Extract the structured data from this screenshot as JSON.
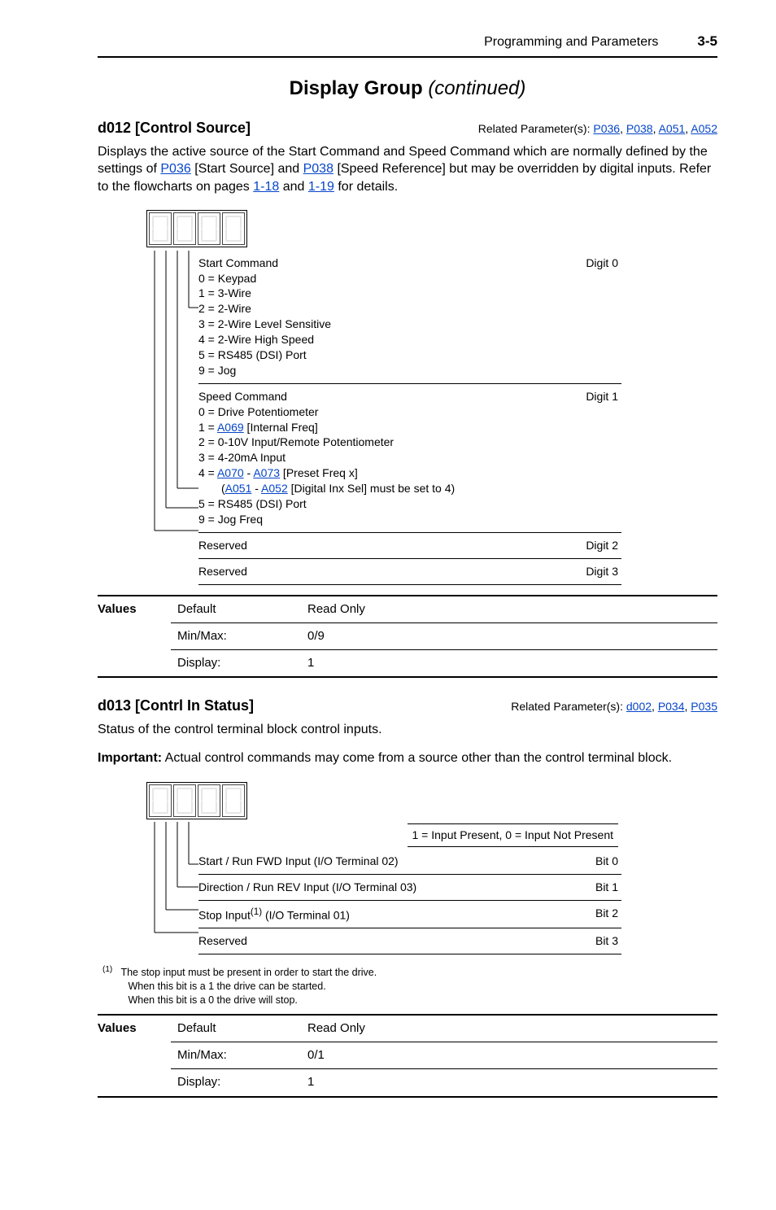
{
  "header": {
    "title": "Programming and Parameters",
    "page": "3-5"
  },
  "section": {
    "title": "Display Group",
    "cont": "(continued)"
  },
  "d012": {
    "name": "d012 [Control Source]",
    "related_label": "Related Parameter(s): ",
    "related_links": [
      {
        "text": "P036"
      },
      {
        "text": "P038"
      },
      {
        "text": "A051"
      },
      {
        "text": "A052"
      }
    ],
    "desc_pre": "Displays the active source of the Start Command and Speed Command which are normally defined by the settings of ",
    "desc_mid1": " [Start Source] and ",
    "desc_mid2": " [Speed Reference] but may be overridden by digital inputs. Refer to the flowcharts on pages ",
    "desc_and": " and ",
    "desc_post": " for details.",
    "link_p036": "P036",
    "link_p038": "P038",
    "link_118": "1-18",
    "link_119": "1-19",
    "rows": {
      "r0_label": "Start Command",
      "r0_lines": [
        "0 = Keypad",
        "1 = 3-Wire",
        "2 = 2-Wire",
        "3 = 2-Wire Level Sensitive",
        "4 = 2-Wire High Speed",
        "5 = RS485 (DSI) Port",
        "9 = Jog"
      ],
      "r0_digit": "Digit 0",
      "r1_label": "Speed Command",
      "r1_lines_pre": "0 = Drive Potentiometer",
      "r1_l2a": "1 = ",
      "r1_l2_link": "A069",
      "r1_l2b": " [Internal Freq]",
      "r1_l3": "2 = 0-10V Input/Remote Potentiometer",
      "r1_l4": "3 = 4-20mA Input",
      "r1_l5a": "4 = ",
      "r1_l5_link1": "A070",
      "r1_l5_mid": " - ",
      "r1_l5_link2": "A073",
      "r1_l5b": " [Preset Freq x]",
      "r1_l6a": "(",
      "r1_l6_link1": "A051",
      "r1_l6_mid": " - ",
      "r1_l6_link2": "A052",
      "r1_l6b": " [Digital Inx Sel] must be set to 4)",
      "r1_l7": "5 = RS485 (DSI) Port",
      "r1_l8": "9 = Jog Freq",
      "r1_digit": "Digit 1",
      "r2_label": "Reserved",
      "r2_digit": "Digit 2",
      "r3_label": "Reserved",
      "r3_digit": "Digit 3"
    },
    "values": {
      "label": "Values",
      "default_k": "Default",
      "default_v": "Read Only",
      "minmax_k": "Min/Max:",
      "minmax_v": "0/9",
      "display_k": "Display:",
      "display_v": "1"
    }
  },
  "d013": {
    "name": "d013 [Contrl In Status]",
    "related_label": "Related Parameter(s): ",
    "related_links": [
      {
        "text": "d002"
      },
      {
        "text": "P034"
      },
      {
        "text": "P035"
      }
    ],
    "desc1": "Status of the control terminal block control inputs.",
    "imp_label": "Important:",
    "imp_text": " Actual control commands may come from a source other than the control terminal block.",
    "caption": "1 = Input Present, 0 = Input Not Present",
    "rows": [
      {
        "left": "Start / Run FWD Input (I/O Terminal 02)",
        "right": "Bit 0"
      },
      {
        "left": "Direction / Run REV Input (I/O Terminal 03)",
        "right": "Bit 1"
      },
      {
        "left": "Stop Input(1) (I/O Terminal 01)",
        "right": "Bit 2",
        "sup": true
      },
      {
        "left": "Reserved",
        "right": "Bit 3"
      }
    ],
    "footnote_marker": "(1)",
    "footnote_lines": [
      "The stop input must be present in order to start the drive.",
      "When this bit is a 1 the drive can be started.",
      "When this bit is a 0 the drive will stop."
    ],
    "values": {
      "label": "Values",
      "default_k": "Default",
      "default_v": "Read Only",
      "minmax_k": "Min/Max:",
      "minmax_v": "0/1",
      "display_k": "Display:",
      "display_v": "1"
    }
  }
}
